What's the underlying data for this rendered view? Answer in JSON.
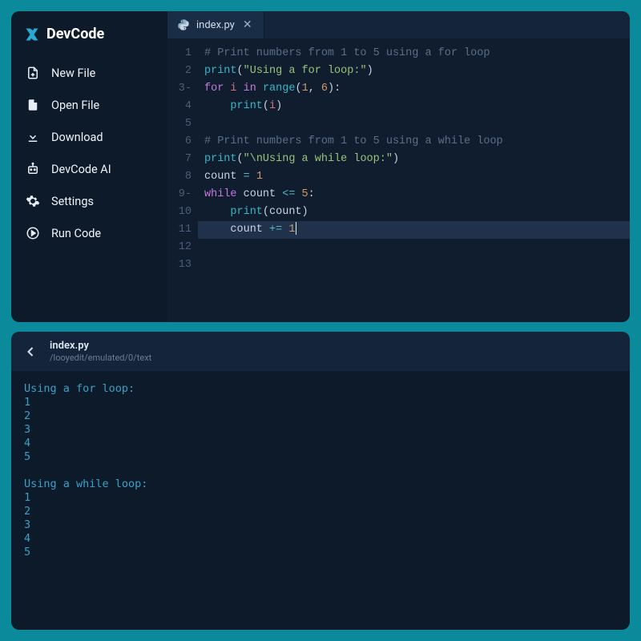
{
  "app": {
    "title": "DevCode"
  },
  "sidebar": {
    "items": [
      {
        "label": "New File"
      },
      {
        "label": "Open File"
      },
      {
        "label": "Download"
      },
      {
        "label": "DevCode AI"
      },
      {
        "label": "Settings"
      },
      {
        "label": "Run Code"
      }
    ]
  },
  "tab": {
    "filename": "index.py"
  },
  "code": {
    "lines": [
      {
        "n": "1",
        "fold": "",
        "tokens": [
          [
            "cm",
            "# Print numbers from 1 to 5 using a for loop"
          ]
        ]
      },
      {
        "n": "2",
        "fold": "",
        "tokens": [
          [
            "fn",
            "print"
          ],
          [
            "id",
            "("
          ],
          [
            "str",
            "\"Using a for loop:\""
          ],
          [
            "id",
            ")"
          ]
        ]
      },
      {
        "n": "3",
        "fold": "-",
        "tokens": [
          [
            "kw",
            "for"
          ],
          [
            "id",
            " "
          ],
          [
            "var",
            "i"
          ],
          [
            "id",
            " "
          ],
          [
            "kw",
            "in"
          ],
          [
            "id",
            " "
          ],
          [
            "fn",
            "range"
          ],
          [
            "id",
            "("
          ],
          [
            "num",
            "1"
          ],
          [
            "id",
            ", "
          ],
          [
            "num",
            "6"
          ],
          [
            "id",
            "):"
          ]
        ]
      },
      {
        "n": "4",
        "fold": "",
        "tokens": [
          [
            "id",
            "    "
          ],
          [
            "fn",
            "print"
          ],
          [
            "id",
            "("
          ],
          [
            "var",
            "i"
          ],
          [
            "id",
            ")"
          ]
        ]
      },
      {
        "n": "5",
        "fold": "",
        "tokens": []
      },
      {
        "n": "6",
        "fold": "",
        "tokens": [
          [
            "cm",
            "# Print numbers from 1 to 5 using a while loop"
          ]
        ]
      },
      {
        "n": "7",
        "fold": "",
        "tokens": [
          [
            "fn",
            "print"
          ],
          [
            "id",
            "("
          ],
          [
            "str",
            "\"\\nUsing a while loop:\""
          ],
          [
            "id",
            ")"
          ]
        ]
      },
      {
        "n": "8",
        "fold": "",
        "tokens": [
          [
            "id",
            "count "
          ],
          [
            "op",
            "="
          ],
          [
            "id",
            " "
          ],
          [
            "num",
            "1"
          ]
        ]
      },
      {
        "n": "9",
        "fold": "-",
        "tokens": [
          [
            "kw",
            "while"
          ],
          [
            "id",
            " count "
          ],
          [
            "op",
            "<="
          ],
          [
            "id",
            " "
          ],
          [
            "num",
            "5"
          ],
          [
            "id",
            ":"
          ]
        ]
      },
      {
        "n": "10",
        "fold": "",
        "tokens": [
          [
            "id",
            "    "
          ],
          [
            "fn",
            "print"
          ],
          [
            "id",
            "(count)"
          ]
        ]
      },
      {
        "n": "11",
        "fold": "",
        "tokens": [
          [
            "id",
            "    count "
          ],
          [
            "op",
            "+="
          ],
          [
            "id",
            " "
          ],
          [
            "num",
            "1"
          ]
        ],
        "current": true
      },
      {
        "n": "12",
        "fold": "",
        "tokens": []
      },
      {
        "n": "13",
        "fold": "",
        "tokens": []
      }
    ]
  },
  "output": {
    "filename": "index.py",
    "path": "/looyedit/emulated/0/text",
    "text": "Using a for loop:\n1\n2\n3\n4\n5\n\nUsing a while loop:\n1\n2\n3\n4\n5"
  }
}
